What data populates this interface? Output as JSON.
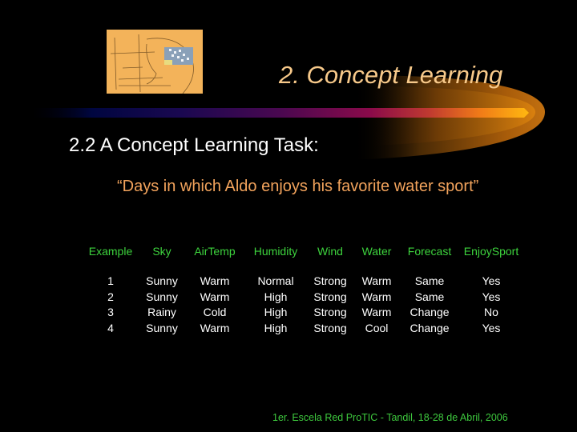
{
  "slide": {
    "title": "2. Concept Learning",
    "subtitle": "2.2  A Concept Learning Task:",
    "quote": "“Days in which Aldo enjoys his favorite water sport”",
    "logo_icon": "sketch-head-icon",
    "table": {
      "headers": [
        "Example",
        "Sky",
        "AirTemp",
        "Humidity",
        "Wind",
        "Water",
        "Forecast",
        "EnjoySport"
      ],
      "rows": [
        [
          "1",
          "Sunny",
          "Warm",
          "Normal",
          "Strong",
          "Warm",
          "Same",
          "Yes"
        ],
        [
          "2",
          "Sunny",
          "Warm",
          "High",
          "Strong",
          "Warm",
          "Same",
          "Yes"
        ],
        [
          "3",
          "Rainy",
          "Cold",
          "High",
          "Strong",
          "Warm",
          "Change",
          "No"
        ],
        [
          "4",
          "Sunny",
          "Warm",
          "High",
          "Strong",
          "Cool",
          "Change",
          "Yes"
        ]
      ]
    },
    "footer": "1er. Escela Red ProTIC - Tandil, 18-28 de Abril, 2006"
  },
  "colors": {
    "background": "#000000",
    "title": "#f7c98a",
    "subtitle": "#ffffff",
    "quote": "#f2a35c",
    "table_header": "#3dd33d",
    "table_cell": "#ffffff",
    "footer": "#3ec93e"
  }
}
